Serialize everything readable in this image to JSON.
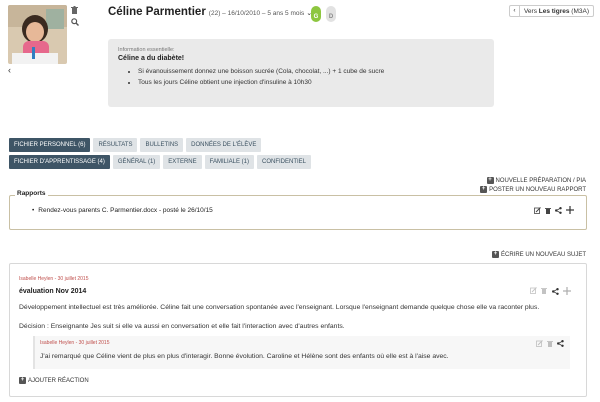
{
  "profile": {
    "name": "Céline Parmentier",
    "meta": "(22) – 16/10/2010 – 5 ans 5 mois",
    "gender_left": "G",
    "gender_right": "D"
  },
  "nav": {
    "prefix": "Vers",
    "target": "Les tigres",
    "group": "(M3A)"
  },
  "info": {
    "caption": "Information essentielle:",
    "title": "Céline a du diabète!",
    "items": [
      "Si évanouissement donnez une boisson sucrée (Cola, chocolat, ...) + 1 cube de sucre",
      "Tous les jours Céline obtient une injection d'insuline à 10h30"
    ]
  },
  "tabs_row1": [
    {
      "label": "FICHIER PERSONNEL (6)",
      "active": true
    },
    {
      "label": "RÉSULTATS",
      "active": false
    },
    {
      "label": "BULLETINS",
      "active": false
    },
    {
      "label": "DONNÉES DE L'ÉLÈVE",
      "active": false
    }
  ],
  "tabs_row2": [
    {
      "label": "FICHIER D'APPRENTISSAGE (4)",
      "active": true
    },
    {
      "label": "GÉNÉRAL (1)",
      "active": false
    },
    {
      "label": "EXTERNE",
      "active": false
    },
    {
      "label": "FAMILIALE (1)",
      "active": false
    },
    {
      "label": "CONFIDENTIEL",
      "active": false
    }
  ],
  "actions": {
    "new_prep": "NOUVELLE PRÉPARATION / PIA",
    "new_report": "POSTER UN NOUVEAU RAPPORT",
    "new_subject": "ÉCRIRE UN NOUVEAU SUJET",
    "add_reaction": "AJOUTER RÉACTION"
  },
  "reports": {
    "legend": "Rapports",
    "items": [
      "Rendez-vous parents C. Parmentier.docx - posté le 26/10/15"
    ]
  },
  "post": {
    "author": "Isabelle Heylen - 30 juillet 2015",
    "title": "évaluation Nov 2014",
    "paragraphs": [
      "Développement intellectuel est très améliorée. Céline fait une conversation spontanée avec l'enseignant. Lorsque l'enseignant demande quelque chose elle va raconter plus.",
      "Décision : Enseignante Jes suit si elle va aussi en conversation et elle fait l'interaction avec d'autres enfants."
    ],
    "reply": {
      "author": "Isabelle Heylen - 30 juillet 2015",
      "text": "J'ai remarqué que Céline vient de plus en plus d'interagir. Bonne évolution. Caroline et Hélène sont des enfants où elle est à l'aise avec."
    }
  },
  "colors": {
    "tab_active": "#3e5566",
    "tab_inactive": "#dfe3e6",
    "panel_border": "#c9c0a4",
    "gender_active": "#8dc63f",
    "author": "#c0504d"
  }
}
